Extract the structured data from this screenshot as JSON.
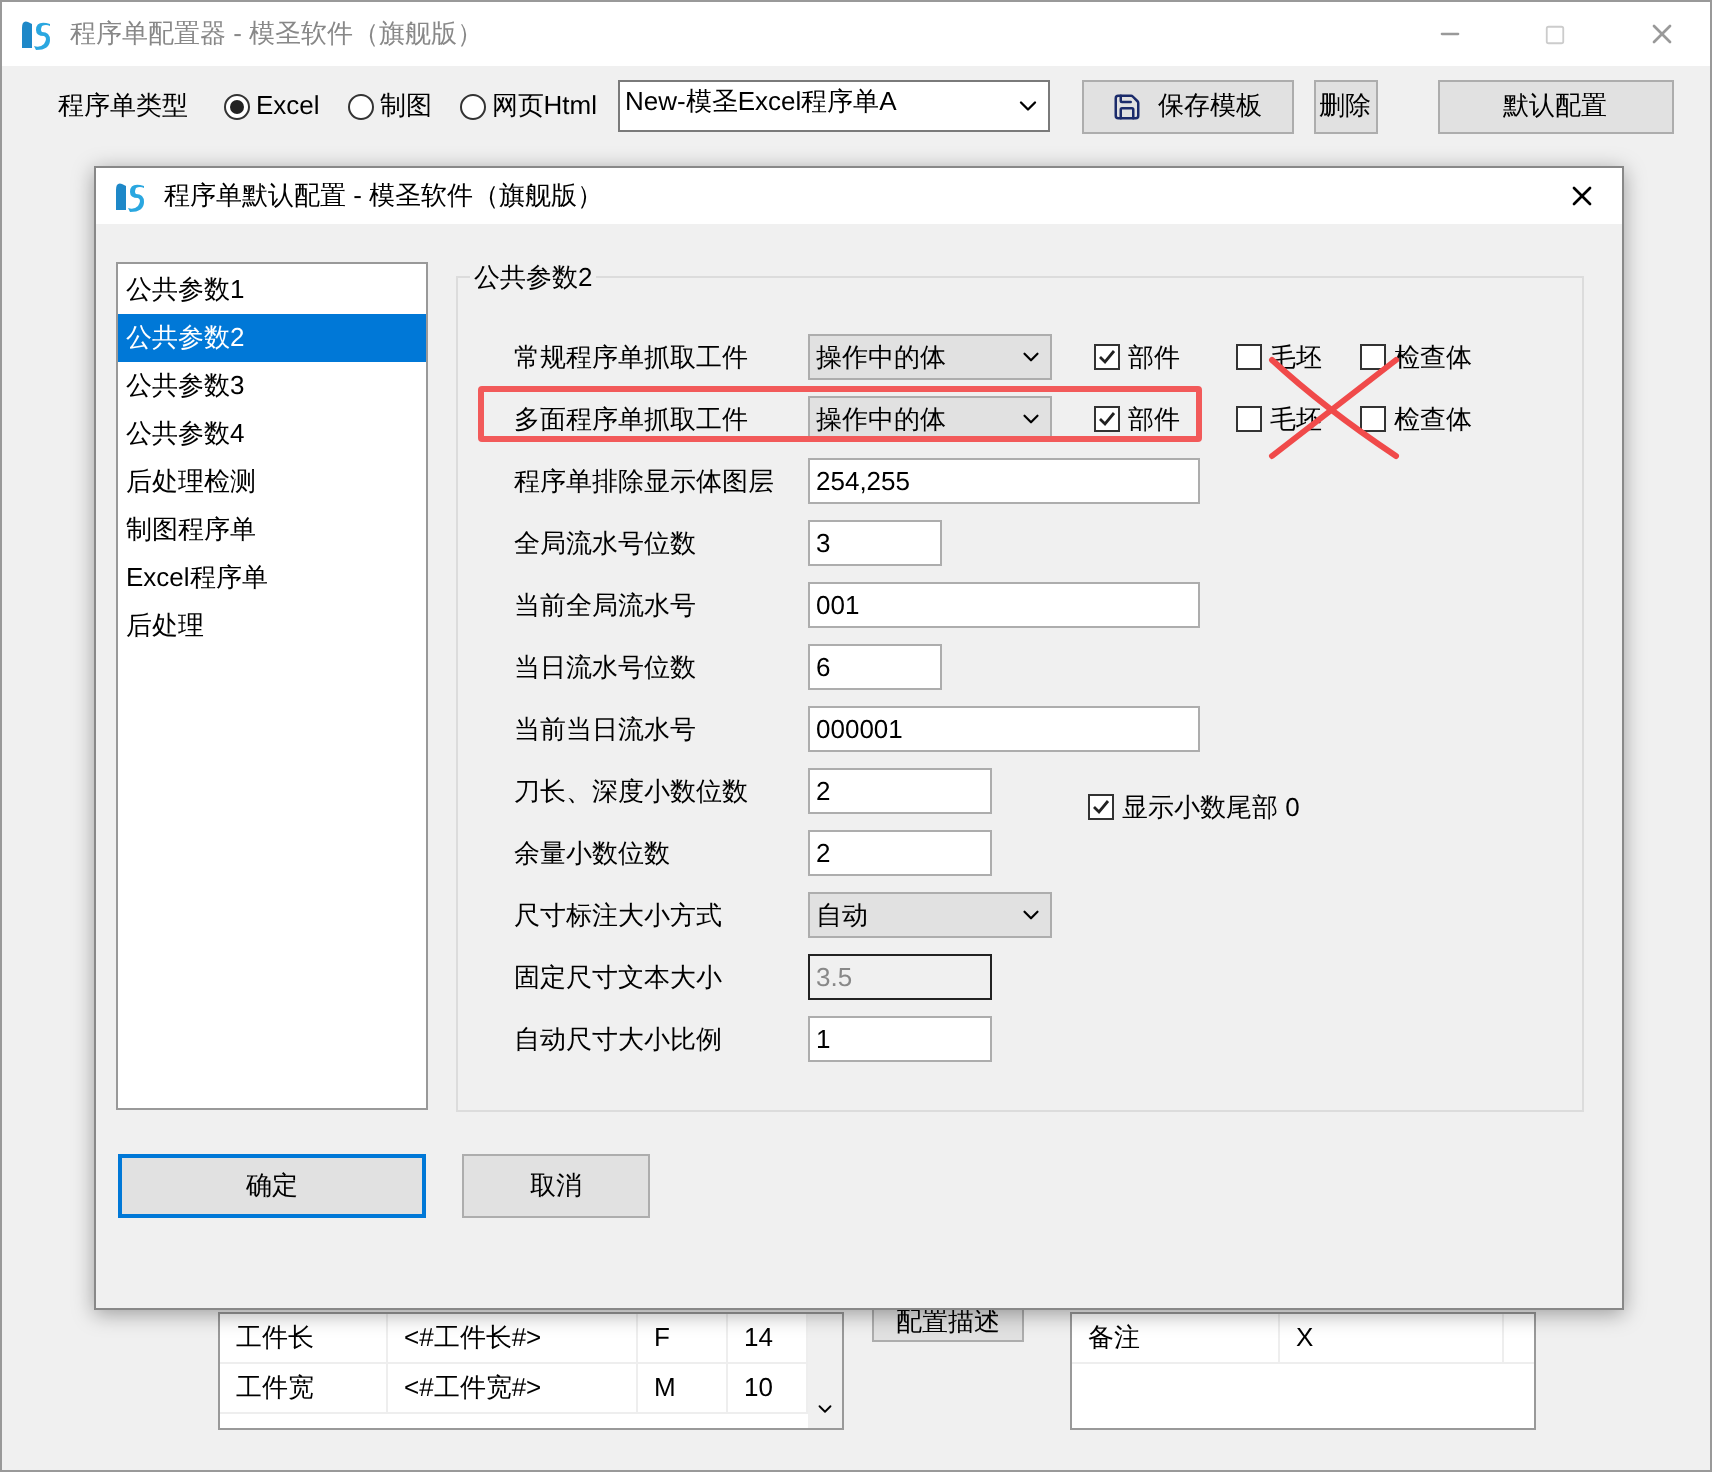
{
  "window": {
    "title": "程序单配置器 - 模圣软件（旗舰版）"
  },
  "toolbar": {
    "type_label": "程序单类型",
    "radios": [
      {
        "label": "Excel",
        "selected": true
      },
      {
        "label": "制图",
        "selected": false
      },
      {
        "label": "网页Html",
        "selected": false
      }
    ],
    "template": {
      "value": "New-模圣Excel程序单A"
    },
    "buttons": [
      {
        "label": "保存模板",
        "kind": "save"
      },
      {
        "label": "删除",
        "kind": "plain"
      },
      {
        "label": "默认配置",
        "kind": "wide"
      }
    ]
  },
  "background": {
    "left_table": {
      "rows": [
        [
          "工件长",
          "<#工件长#>",
          "F",
          "14"
        ],
        [
          "工件宽",
          "<#工件宽#>",
          "M",
          "10"
        ]
      ]
    },
    "describe_button": "配置描述",
    "right_table": {
      "rows": [
        [
          "备注",
          "X"
        ]
      ]
    }
  },
  "dialog": {
    "title": "程序单默认配置 - 模圣软件（旗舰版）",
    "sidebar": {
      "items": [
        {
          "label": "公共参数1",
          "selected": false
        },
        {
          "label": "公共参数2",
          "selected": true
        },
        {
          "label": "公共参数3",
          "selected": false
        },
        {
          "label": "公共参数4",
          "selected": false
        },
        {
          "label": "后处理检测",
          "selected": false
        },
        {
          "label": "制图程序单",
          "selected": false
        },
        {
          "label": "Excel程序单",
          "selected": false
        },
        {
          "label": "后处理",
          "selected": false
        }
      ]
    },
    "group": {
      "title": "公共参数2",
      "rows": [
        {
          "label": "常规程序单抓取工件",
          "kind": "select",
          "value": "操作中的体",
          "highlighted": false,
          "crossed": false,
          "checks": [
            {
              "label": "部件",
              "checked": true
            },
            {
              "label": "毛坯",
              "checked": false
            },
            {
              "label": "检查体",
              "checked": false
            }
          ]
        },
        {
          "label": "多面程序单抓取工件",
          "kind": "select",
          "value": "操作中的体",
          "highlighted": true,
          "crossed": true,
          "checks": [
            {
              "label": "部件",
              "checked": true
            },
            {
              "label": "毛坯",
              "checked": false
            },
            {
              "label": "检查体",
              "checked": false
            }
          ]
        },
        {
          "label": "程序单排除显示体图层",
          "kind": "wide",
          "value": "254,255"
        },
        {
          "label": "全局流水号位数",
          "kind": "short",
          "value": "3"
        },
        {
          "label": "当前全局流水号",
          "kind": "wide",
          "value": "001"
        },
        {
          "label": "当日流水号位数",
          "kind": "short",
          "value": "6"
        },
        {
          "label": "当前当日流水号",
          "kind": "wide",
          "value": "000001"
        },
        {
          "label": "刀长、深度小数位数",
          "kind": "medium",
          "value": "2",
          "check": {
            "label": "显示小数尾部 0",
            "checked": true
          }
        },
        {
          "label": "余量小数位数",
          "kind": "medium",
          "value": "2"
        },
        {
          "label": "尺寸标注大小方式",
          "kind": "select",
          "value": "自动"
        },
        {
          "label": "固定尺寸文本大小",
          "kind": "medium",
          "value": "3.5",
          "disabled": true
        },
        {
          "label": "自动尺寸大小比例",
          "kind": "medium",
          "value": "1"
        }
      ]
    },
    "buttons": [
      {
        "label": "确定",
        "kind": "default"
      },
      {
        "label": "取消",
        "kind": "plain"
      }
    ]
  }
}
